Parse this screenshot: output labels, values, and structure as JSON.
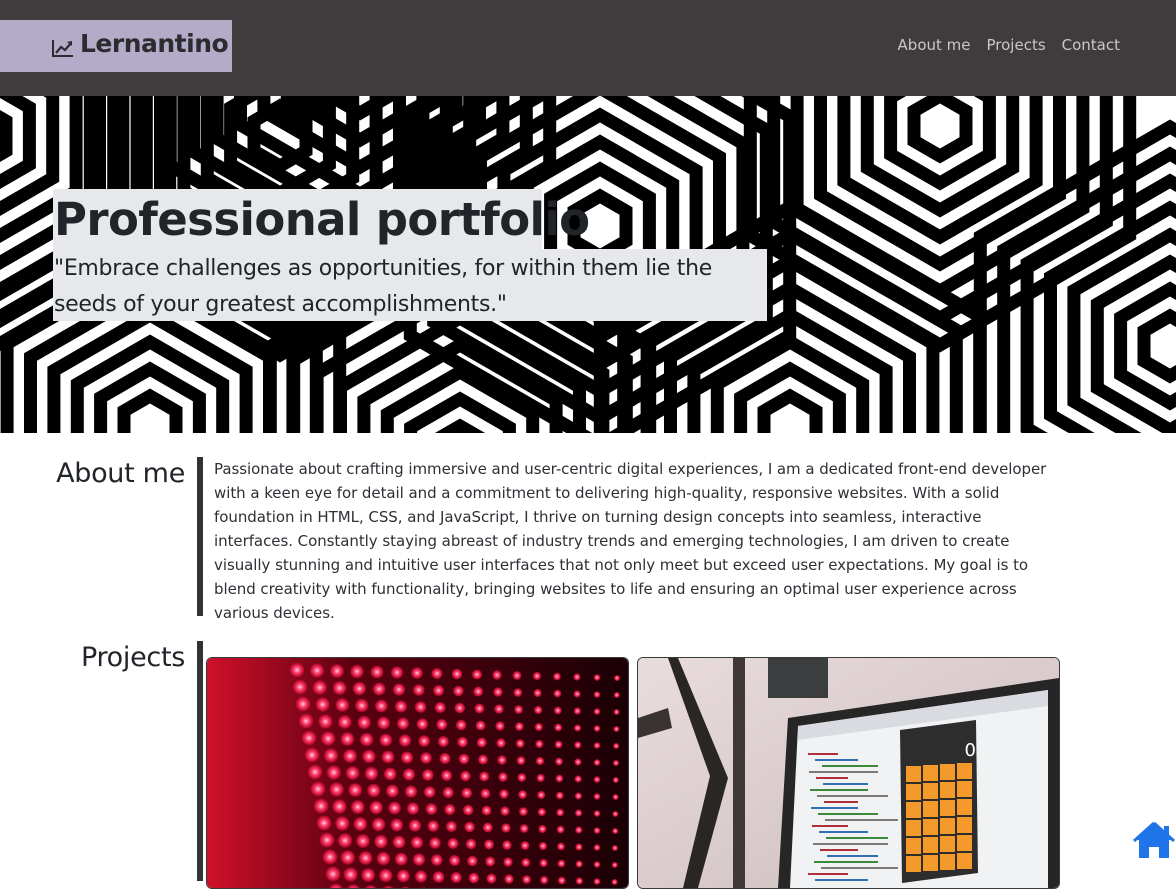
{
  "navbar": {
    "brand": "Lernantino",
    "brand_icon": "line-chart-icon",
    "links": [
      "About me",
      "Projects",
      "Contact"
    ]
  },
  "hero": {
    "title": "Professional portfolio",
    "quote": "\"Embrace challenges as opportunities, for within them lie the seeds of your greatest accomplishments.\""
  },
  "about": {
    "heading": "About me",
    "text": "Passionate about crafting immersive and user-centric digital experiences, I am a dedicated front-end developer with a keen eye for detail and a commitment to delivering high-quality, responsive websites. With a solid foundation in HTML, CSS, and JavaScript, I thrive on turning design concepts into seamless, interactive interfaces. Constantly staying abreast of industry trends and emerging technologies, I am driven to create visually stunning and intuitive user interfaces that not only meet but exceed user expectations. My goal is to blend creativity with functionality, bringing websites to life and ensuring an optimal user experience across various devices."
  },
  "projects": {
    "heading": "Projects",
    "cards": [
      {
        "image": "red-led-matrix-photo"
      },
      {
        "image": "laptop-calculator-app-photo",
        "display_value": "0"
      }
    ]
  },
  "home_button": {
    "icon": "home-icon",
    "color": "#1e74e8"
  },
  "colors": {
    "navbar": "#3f3c3e",
    "brand_bg": "#b3abc8",
    "hero_text_bg": "#e6e8eb",
    "accent_bar": "#333333"
  }
}
